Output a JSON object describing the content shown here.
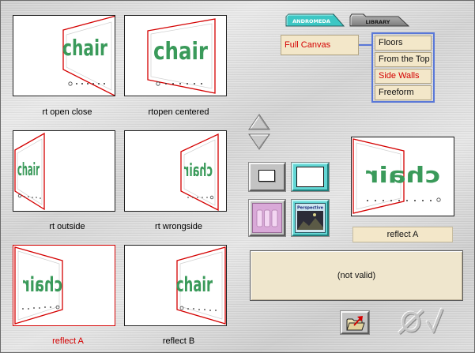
{
  "tabs": {
    "andromeda": {
      "label": "ANDROMEDA",
      "active": true
    },
    "library": {
      "label": "LIBRARY",
      "active": false
    }
  },
  "canvas_mode": {
    "label": "Full Canvas"
  },
  "mode_options": [
    {
      "label": "Floors",
      "selected": false
    },
    {
      "label": "From the Top",
      "selected": false
    },
    {
      "label": "Side Walls",
      "selected": true
    },
    {
      "label": "Freeform",
      "selected": false
    }
  ],
  "presets": [
    {
      "label": "rt open close",
      "selected": false
    },
    {
      "label": "rtopen centered",
      "selected": false
    },
    {
      "label": "rt outside",
      "selected": false
    },
    {
      "label": "rt wrongside",
      "selected": false
    },
    {
      "label": "reflect A",
      "selected": true
    },
    {
      "label": "reflect B",
      "selected": false
    }
  ],
  "thumbnail_text": "chair",
  "preview": {
    "label": "reflect A"
  },
  "status": {
    "text": "(not valid)"
  },
  "buttons": {
    "perspective_thumb_label": "Perspective"
  },
  "icons": {
    "scroll_up": "arrow-up-icon",
    "scroll_down": "arrow-down-icon",
    "frame_small": "frame-small-icon",
    "frame_full": "frame-full-icon",
    "tile": "tiles-icon",
    "perspective": "perspective-thumb-icon",
    "export": "folder-export-icon",
    "cancel": "cancel-icon",
    "apply": "checkmark-icon"
  },
  "colors": {
    "selected_text": "#d40000",
    "plane_outline": "#d40000",
    "sample_text": "#3a9a5a",
    "tab_active": "#3cc7c4",
    "list_border": "#5a78d8",
    "field_bg": "#f3e7c9"
  }
}
